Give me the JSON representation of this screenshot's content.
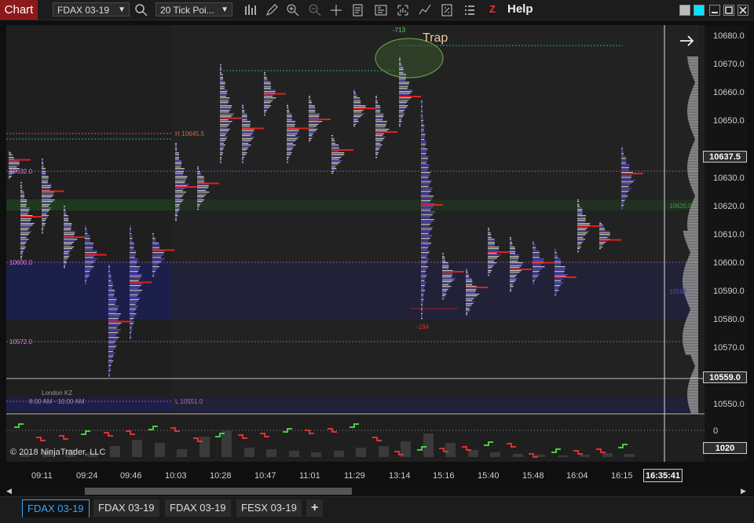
{
  "toolbar": {
    "chart_label": "Chart",
    "instrument": "FDAX 03-19",
    "interval": "20 Tick Poi...",
    "help": "Help",
    "z_logo": "Z"
  },
  "annotation": {
    "trap": "Trap",
    "top_count": "-713",
    "bottom_count": "-194",
    "copyright": "© 2018 NinjaTrader, LLC",
    "london_kz": "London KZ",
    "london_kz_time": "8:00 AM - 10:00 AM"
  },
  "levels": {
    "high": "H 10645.5",
    "low": "L 10551.0",
    "l1": "10632.0",
    "l2": "10600.0",
    "l3": "10572.0",
    "poc_right": "10620.0",
    "va_right": "10588"
  },
  "price_axis": {
    "ticks": [
      "10680.0",
      "10670.0",
      "10660.0",
      "10650.0",
      "10640.0",
      "10630.0",
      "10620.0",
      "10610.0",
      "10600.0",
      "10590.0",
      "10580.0",
      "10570.0",
      "10560.0",
      "10550.0"
    ],
    "current_price": "10637.5",
    "price_559": "10559.0",
    "lower_zero": "0",
    "lower_value": "1020"
  },
  "time_axis": {
    "labels": [
      "09:11",
      "09:24",
      "09:46",
      "10:03",
      "10:28",
      "10:47",
      "11:01",
      "11:29",
      "13:14",
      "15:16",
      "15:40",
      "15:48",
      "16:04",
      "16:15"
    ],
    "cursor_time": "16:35:41"
  },
  "tabs": [
    {
      "label": "FDAX 03-19",
      "active": true
    },
    {
      "label": "FDAX 03-19",
      "active": false
    },
    {
      "label": "FDAX 03-19",
      "active": false
    },
    {
      "label": "FESX 03-19",
      "active": false
    }
  ],
  "add_tab": "+",
  "colors": {
    "value_area": "#1c1f4a",
    "poc_band": "#1d3a1d",
    "poc_line": "#e02020",
    "profile_blue": "#5a4fc8",
    "profile_gray": "#c8c8c8",
    "chart_bg": "#1f1f1f"
  }
}
